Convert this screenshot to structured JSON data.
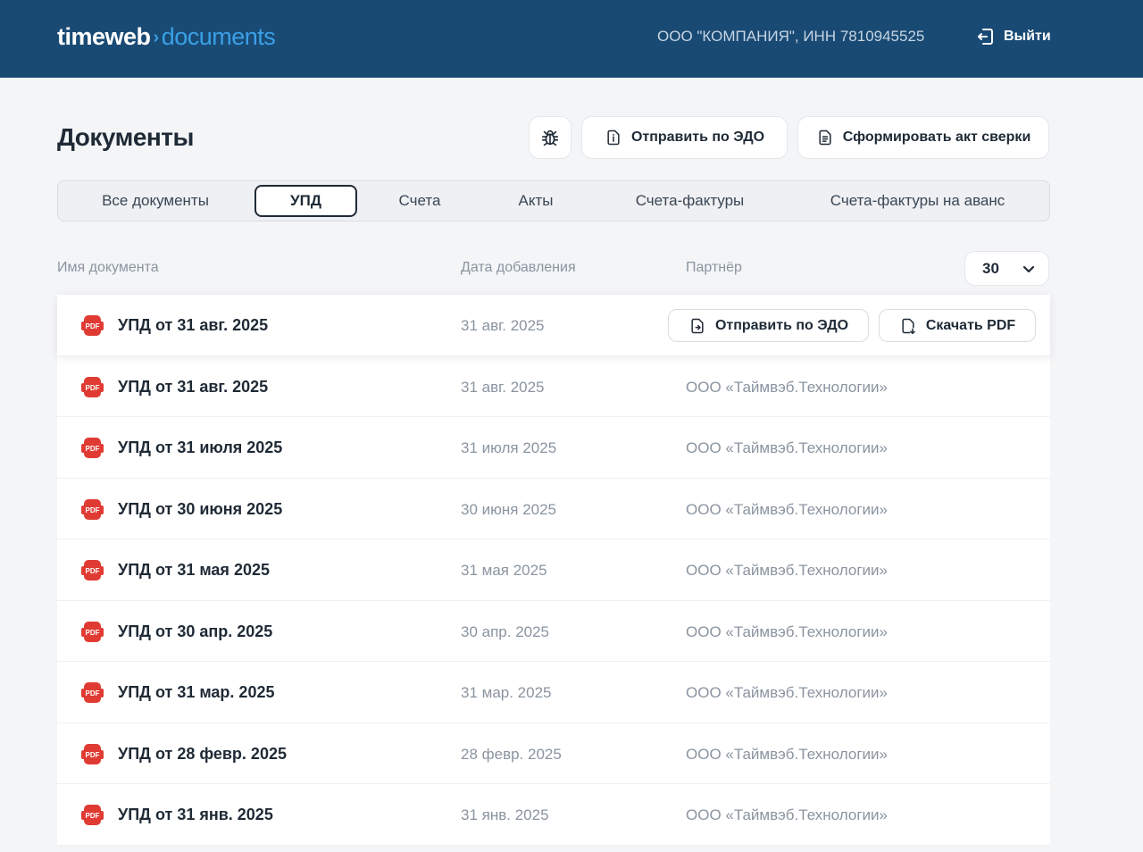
{
  "header": {
    "logo_primary": "timeweb",
    "logo_separator": "›",
    "logo_secondary": "documents",
    "company": "ООО \"КОМПАНИЯ\",  ИНН 7810945525",
    "logout_label": "Выйти",
    "colors": {
      "background": "#194a74",
      "accent": "#3aa0e6"
    }
  },
  "page": {
    "title": "Документы",
    "bug_icon": "bug-icon",
    "send_edo_label": "Отправить по ЭДО",
    "reconciliation_label": "Сформировать акт сверки"
  },
  "tabs": [
    {
      "label": "Все документы",
      "active": false
    },
    {
      "label": "УПД",
      "active": true
    },
    {
      "label": "Счета",
      "active": false
    },
    {
      "label": "Акты",
      "active": false
    },
    {
      "label": "Счета-фактуры",
      "active": false
    },
    {
      "label": "Счета-фактуры на аванс",
      "active": false
    }
  ],
  "table": {
    "columns": {
      "name": "Имя документа",
      "date": "Дата добавления",
      "partner": "Партнёр"
    },
    "per_page": "30",
    "row_actions": {
      "send_edo": "Отправить по ЭДО",
      "download_pdf": "Скачать PDF"
    },
    "rows": [
      {
        "name": "УПД от 31 авг. 2025",
        "date": "31 авг. 2025",
        "partner": "",
        "hovered": true
      },
      {
        "name": "УПД от 31 авг. 2025",
        "date": "31 авг. 2025",
        "partner": "ООО «Таймвэб.Технологии»"
      },
      {
        "name": "УПД от 31 июля 2025",
        "date": "31 июля 2025",
        "partner": "ООО «Таймвэб.Технологии»"
      },
      {
        "name": "УПД от 30 июня 2025",
        "date": "30 июня 2025",
        "partner": "ООО «Таймвэб.Технологии»"
      },
      {
        "name": "УПД от 31 мая 2025",
        "date": "31 мая 2025",
        "partner": "ООО «Таймвэб.Технологии»"
      },
      {
        "name": "УПД от 30 апр. 2025",
        "date": "30 апр. 2025",
        "partner": "ООО «Таймвэб.Технологии»"
      },
      {
        "name": "УПД от 31 мар. 2025",
        "date": "31 мар. 2025",
        "partner": "ООО «Таймвэб.Технологии»"
      },
      {
        "name": "УПД от 28 февр. 2025",
        "date": "28 февр. 2025",
        "partner": "ООО «Таймвэб.Технологии»"
      },
      {
        "name": "УПД от 31 янв. 2025",
        "date": "31 янв. 2025",
        "partner": "ООО «Таймвэб.Технологии»"
      }
    ]
  }
}
